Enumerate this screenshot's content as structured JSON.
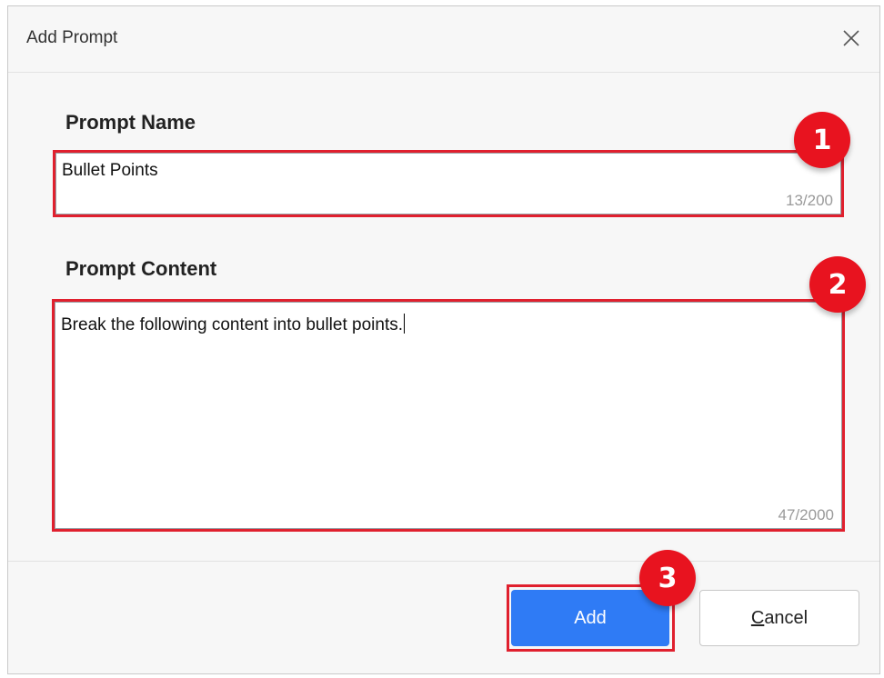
{
  "dialog": {
    "title": "Add Prompt",
    "close_icon": "close-icon"
  },
  "prompt_name": {
    "label": "Prompt Name",
    "value": "Bullet Points",
    "counter": "13/200"
  },
  "prompt_content": {
    "label": "Prompt Content",
    "value": "Break the following content into bullet points.",
    "counter": "47/2000"
  },
  "buttons": {
    "add_label": "Add",
    "cancel_label": "Cancel",
    "cancel_mnemonic": "C",
    "cancel_rest": "ancel"
  },
  "annotations": {
    "badge_1": "1",
    "badge_2": "2",
    "badge_3": "3",
    "highlight_color": "#e0202e",
    "badge_color": "#e8131f"
  },
  "colors": {
    "primary_button": "#2f7bf5"
  }
}
